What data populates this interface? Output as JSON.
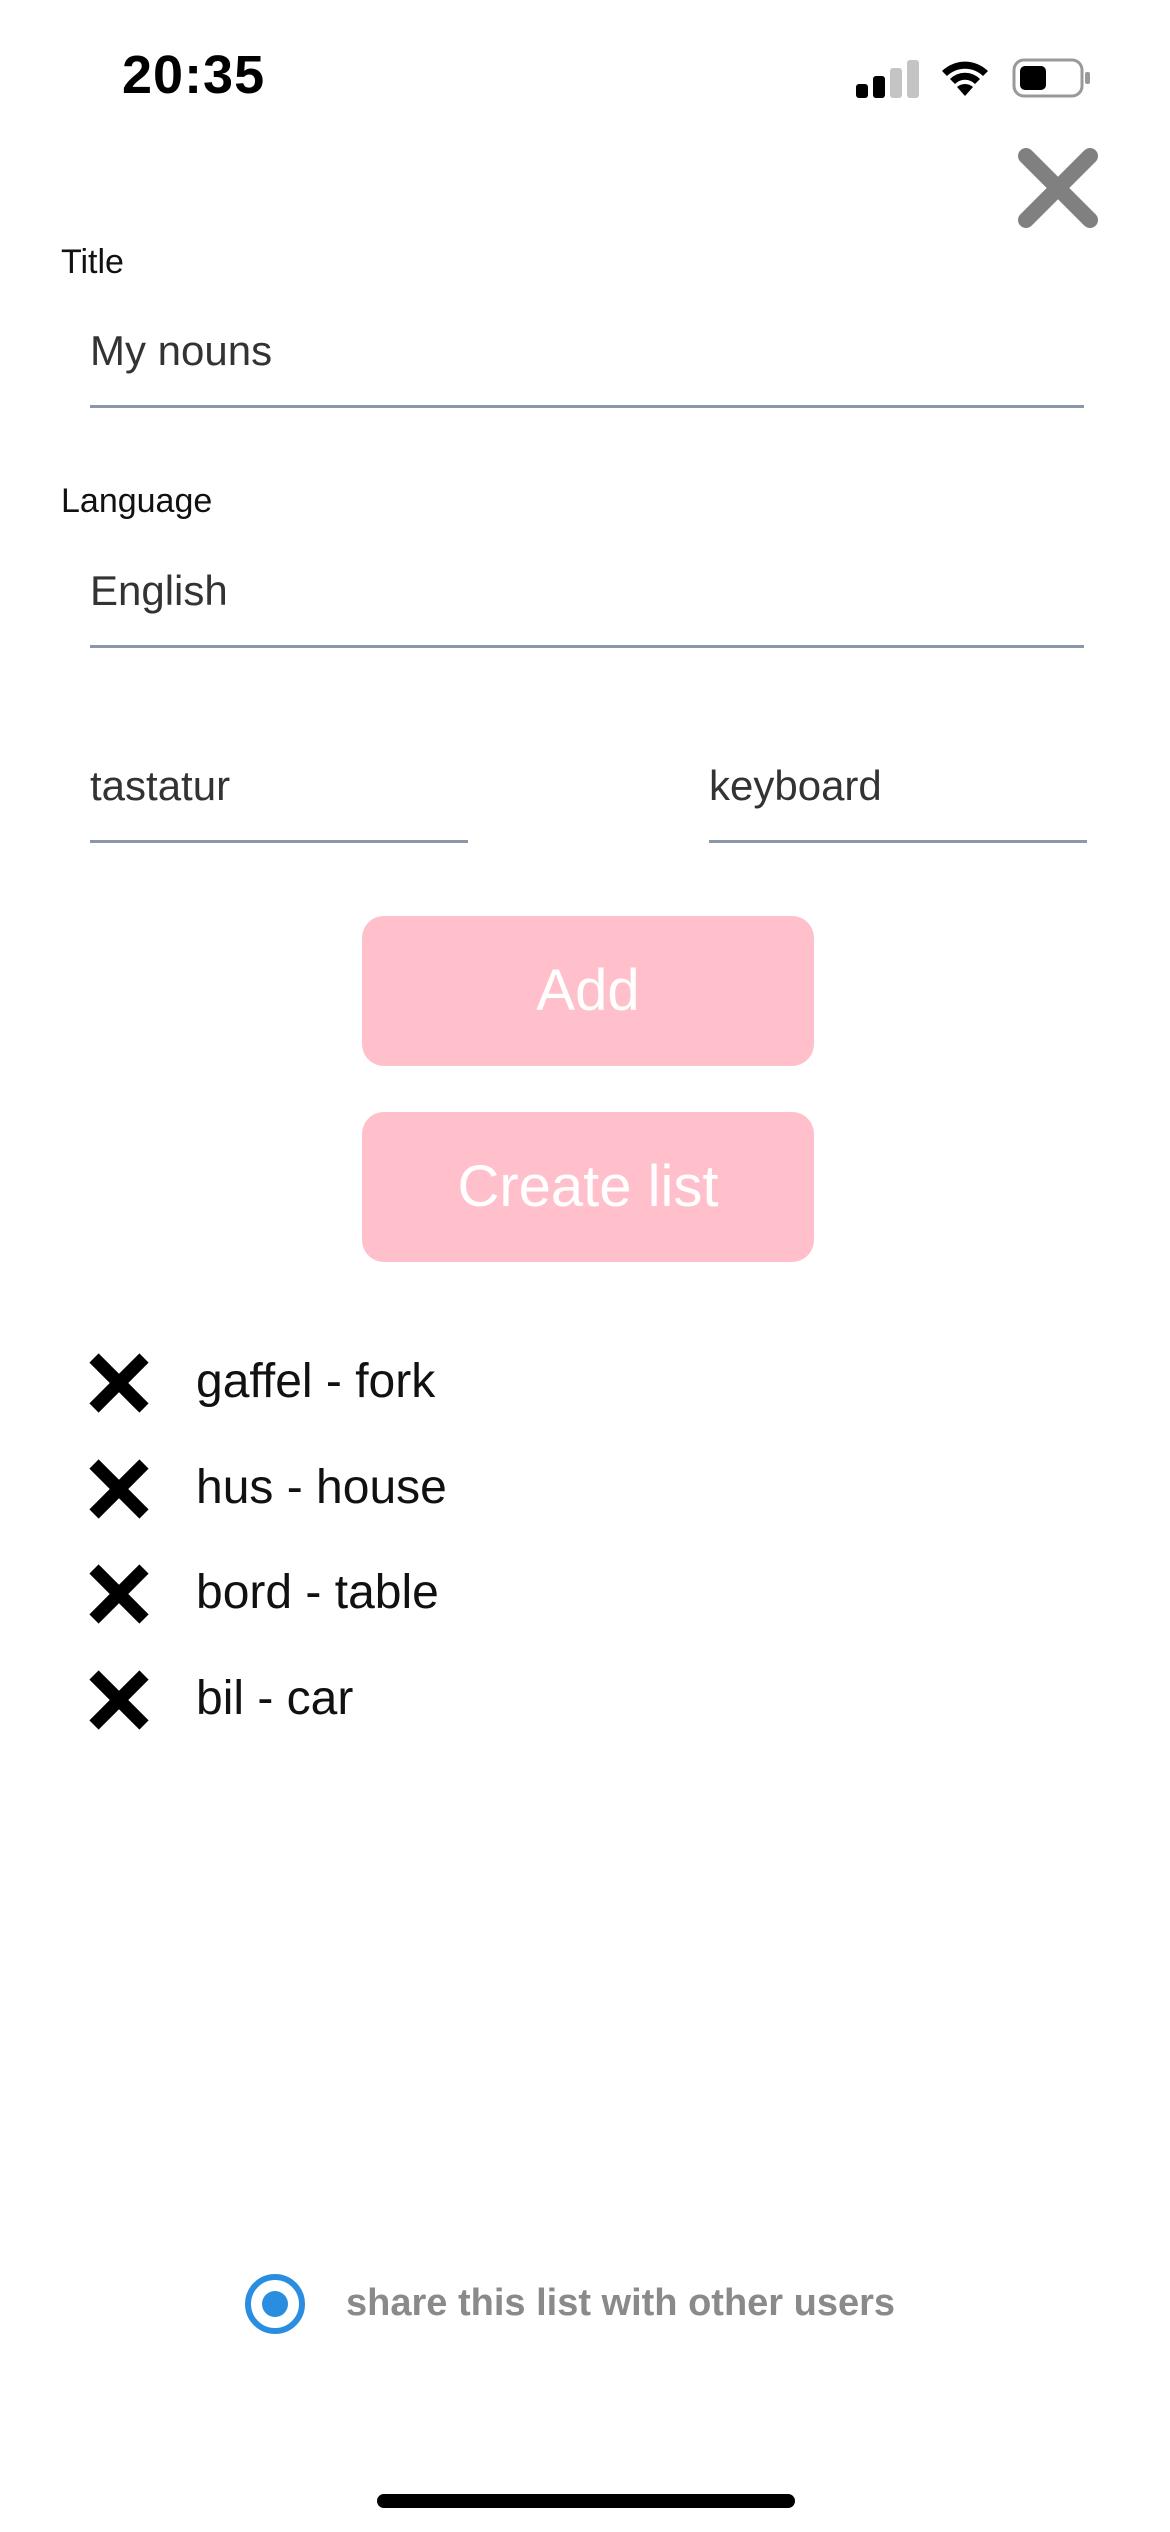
{
  "status_bar": {
    "time": "20:35",
    "signal_bars_active": 2,
    "signal_bars_total": 4,
    "battery_level": 0.45
  },
  "header": {
    "close_icon": "close-icon"
  },
  "form": {
    "title_label": "Title",
    "title_value": "My nouns",
    "language_label": "Language",
    "language_value": "English",
    "word_value": "tastatur",
    "translation_value": "keyboard"
  },
  "buttons": {
    "add_label": "Add",
    "create_label": "Create list"
  },
  "word_list": [
    {
      "text": "gaffel - fork"
    },
    {
      "text": "hus - house"
    },
    {
      "text": "bord - table"
    },
    {
      "text": "bil - car"
    }
  ],
  "share": {
    "label": "share this list with other users",
    "selected": true
  },
  "colors": {
    "accent_pink": "#ffc0cb",
    "radio_blue": "#2a8ee0",
    "underline": "#8a98aa",
    "close_gray": "#808080"
  }
}
